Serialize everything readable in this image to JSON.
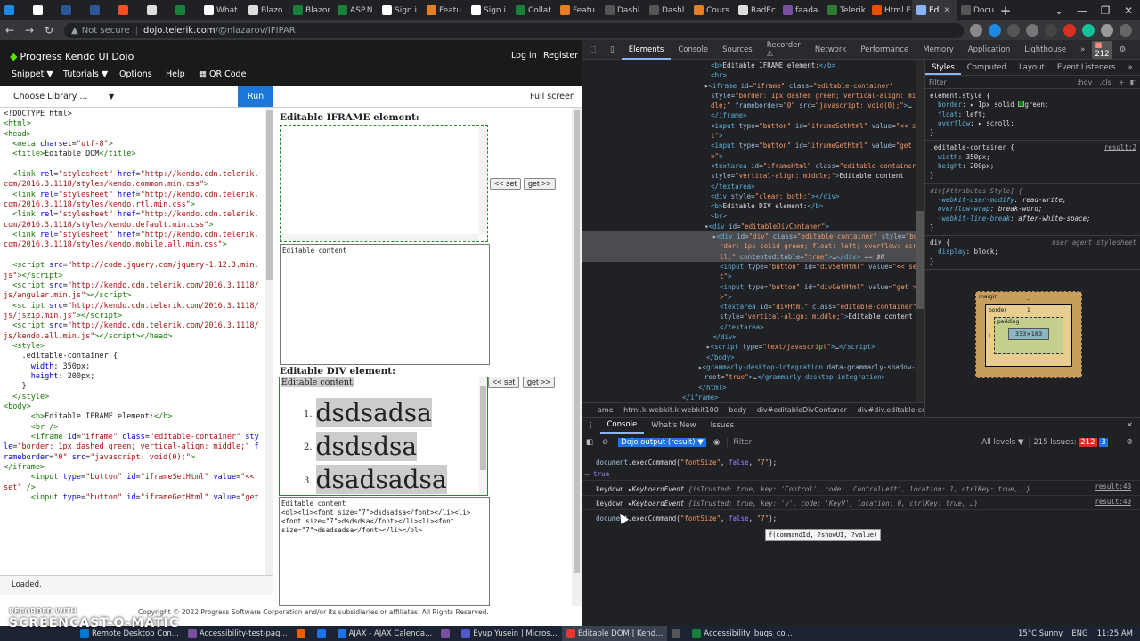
{
  "browser": {
    "tabs": [
      {
        "label": "",
        "color": "#1e88e5"
      },
      {
        "label": "",
        "color": "#fff"
      },
      {
        "label": "",
        "color": "#2b579a"
      },
      {
        "label": "",
        "color": "#2b579a"
      },
      {
        "label": "",
        "color": "#f25022"
      },
      {
        "label": "",
        "color": "#ddd"
      },
      {
        "label": "",
        "color": "#188038"
      },
      {
        "label": "What",
        "color": "#fff"
      },
      {
        "label": "Blazo",
        "color": "#ddd"
      },
      {
        "label": "Blazor",
        "color": "#188038"
      },
      {
        "label": "ASP.N",
        "color": "#188038"
      },
      {
        "label": "Sign i",
        "color": "#fff"
      },
      {
        "label": "Featu",
        "color": "#e67e22"
      },
      {
        "label": "Sign i",
        "color": "#fff"
      },
      {
        "label": "Collat",
        "color": "#188038"
      },
      {
        "label": "Featu",
        "color": "#e67e22"
      },
      {
        "label": "Dashl",
        "color": "#555"
      },
      {
        "label": "Dashl",
        "color": "#555"
      },
      {
        "label": "Cours",
        "color": "#e67e22"
      },
      {
        "label": "RadEc",
        "color": "#ddd"
      },
      {
        "label": "faada",
        "color": "#7b4fa0"
      },
      {
        "label": "Telerik",
        "color": "#2e7d32"
      },
      {
        "label": "Html E",
        "color": "#e65100"
      }
    ],
    "active_tab": "Ed",
    "last_tab": "Docu",
    "url_prefix": "Not secure",
    "url_host": "dojo.telerik.com",
    "url_path": "/@nlazarov/IFIPAR"
  },
  "dojo": {
    "logo": "Progress Kendo UI Dojo",
    "nav": [
      "Snippet ▼",
      "Tutorials ▼",
      "Options",
      "Help",
      "QR Code"
    ],
    "login": "Log in",
    "register": "Register",
    "library_select": "Choose Library ...",
    "run": "Run",
    "fullscreen": "Full screen",
    "status": "Loaded.",
    "copyright": "Copyright © 2022 Progress Software Corporation and/or its subsidiaries or affiliates. All Rights Reserved."
  },
  "result": {
    "iframe_label": "Editable IFRAME element:",
    "div_label": "Editable DIV element:",
    "set_btn": "<< set",
    "get_btn": "get >>",
    "iframe_textarea": "Editable content",
    "div_first_line": "Editable content",
    "list_items": [
      "dsdsadsa",
      "dsdsdsa",
      "dsadsadsa"
    ],
    "div_textarea": "Editable content\n<ol><li><font size=\"7\">dsdsadsa</font></li><li><font size=\"7\">dsdsdsa</font></li><li><font size=\"7\">dsadsadsa</font></li></ol>"
  },
  "devtools": {
    "tabs": [
      "Elements",
      "Console",
      "Sources",
      "Recorder ⚠",
      "Network",
      "Performance",
      "Memory",
      "Application",
      "Lighthouse"
    ],
    "issues_badge": "212",
    "breadcrumb": [
      "ame",
      "html.k-webkit.k-webkit100",
      "body",
      "div#editableDivContaner",
      "div#div.editable-container"
    ],
    "styles_tabs": [
      "Styles",
      "Computed",
      "Layout",
      "Event Listeners"
    ],
    "filter_placeholder": "Filter",
    "hov": ":hov",
    "cls": ".cls",
    "rule_element_style": "element.style {",
    "rule_editable": ".editable-container {",
    "rule_editable_src": "result:2",
    "rule_attr": "div[Attributes Style] {",
    "rule_div": "div {",
    "rule_div_src": "user agent stylesheet",
    "box": {
      "margin": "margin",
      "border": "border",
      "padding": "padding",
      "content": "333×183",
      "dash": "–",
      "one": "1"
    },
    "console_tabs": [
      "Console",
      "What's New",
      "Issues"
    ],
    "console_context": "Dojo output (result) ▼",
    "console_filter": "Filter",
    "levels": "All levels ▼",
    "issues_count": "215 Issues: ",
    "issues_red": "212",
    "issues_blue": "3",
    "tooltip": "f(commandId, ?showUI, ?value)"
  },
  "taskbar": {
    "items": [
      {
        "label": "Remote Desktop Con...",
        "color": "#0078d4"
      },
      {
        "label": "Accessibility-test-pag...",
        "color": "#7b4fa0"
      },
      {
        "label": "",
        "color": "#e66000"
      },
      {
        "label": "",
        "color": "#1a73e8"
      },
      {
        "label": "AJAX - AJAX Calenda...",
        "color": "#1a73e8"
      },
      {
        "label": "",
        "color": "#7b4fa0"
      },
      {
        "label": "Eyup Yusein | Micros...",
        "color": "#5059c9"
      },
      {
        "label": "Editable DOM | Kend...",
        "color": "#e53935"
      },
      {
        "label": "",
        "color": "#555"
      },
      {
        "label": "Accessibility_bugs_co...",
        "color": "#188038"
      }
    ],
    "weather": "15°C  Sunny",
    "lang": "ENG",
    "time": "11:25 AM"
  },
  "watermark": {
    "line1": "RECORDED WITH",
    "line2": "SCREENCAST-O-MATIC"
  }
}
